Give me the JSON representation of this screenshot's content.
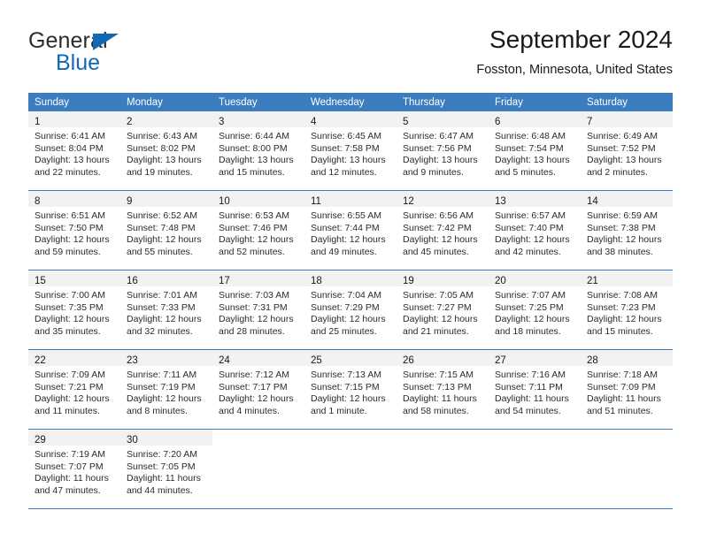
{
  "brand": {
    "name_top": "General",
    "name_bottom": "Blue",
    "accent_color": "#1268b3"
  },
  "header": {
    "title": "September 2024",
    "location": "Fosston, Minnesota, United States"
  },
  "calendar": {
    "header_bg_color": "#3b7dbf",
    "daynum_bg_color": "#f2f2f2",
    "weekdays": [
      "Sunday",
      "Monday",
      "Tuesday",
      "Wednesday",
      "Thursday",
      "Friday",
      "Saturday"
    ],
    "weeks": [
      [
        {
          "day": "1",
          "sunrise": "Sunrise: 6:41 AM",
          "sunset": "Sunset: 8:04 PM",
          "daylight1": "Daylight: 13 hours",
          "daylight2": "and 22 minutes."
        },
        {
          "day": "2",
          "sunrise": "Sunrise: 6:43 AM",
          "sunset": "Sunset: 8:02 PM",
          "daylight1": "Daylight: 13 hours",
          "daylight2": "and 19 minutes."
        },
        {
          "day": "3",
          "sunrise": "Sunrise: 6:44 AM",
          "sunset": "Sunset: 8:00 PM",
          "daylight1": "Daylight: 13 hours",
          "daylight2": "and 15 minutes."
        },
        {
          "day": "4",
          "sunrise": "Sunrise: 6:45 AM",
          "sunset": "Sunset: 7:58 PM",
          "daylight1": "Daylight: 13 hours",
          "daylight2": "and 12 minutes."
        },
        {
          "day": "5",
          "sunrise": "Sunrise: 6:47 AM",
          "sunset": "Sunset: 7:56 PM",
          "daylight1": "Daylight: 13 hours",
          "daylight2": "and 9 minutes."
        },
        {
          "day": "6",
          "sunrise": "Sunrise: 6:48 AM",
          "sunset": "Sunset: 7:54 PM",
          "daylight1": "Daylight: 13 hours",
          "daylight2": "and 5 minutes."
        },
        {
          "day": "7",
          "sunrise": "Sunrise: 6:49 AM",
          "sunset": "Sunset: 7:52 PM",
          "daylight1": "Daylight: 13 hours",
          "daylight2": "and 2 minutes."
        }
      ],
      [
        {
          "day": "8",
          "sunrise": "Sunrise: 6:51 AM",
          "sunset": "Sunset: 7:50 PM",
          "daylight1": "Daylight: 12 hours",
          "daylight2": "and 59 minutes."
        },
        {
          "day": "9",
          "sunrise": "Sunrise: 6:52 AM",
          "sunset": "Sunset: 7:48 PM",
          "daylight1": "Daylight: 12 hours",
          "daylight2": "and 55 minutes."
        },
        {
          "day": "10",
          "sunrise": "Sunrise: 6:53 AM",
          "sunset": "Sunset: 7:46 PM",
          "daylight1": "Daylight: 12 hours",
          "daylight2": "and 52 minutes."
        },
        {
          "day": "11",
          "sunrise": "Sunrise: 6:55 AM",
          "sunset": "Sunset: 7:44 PM",
          "daylight1": "Daylight: 12 hours",
          "daylight2": "and 49 minutes."
        },
        {
          "day": "12",
          "sunrise": "Sunrise: 6:56 AM",
          "sunset": "Sunset: 7:42 PM",
          "daylight1": "Daylight: 12 hours",
          "daylight2": "and 45 minutes."
        },
        {
          "day": "13",
          "sunrise": "Sunrise: 6:57 AM",
          "sunset": "Sunset: 7:40 PM",
          "daylight1": "Daylight: 12 hours",
          "daylight2": "and 42 minutes."
        },
        {
          "day": "14",
          "sunrise": "Sunrise: 6:59 AM",
          "sunset": "Sunset: 7:38 PM",
          "daylight1": "Daylight: 12 hours",
          "daylight2": "and 38 minutes."
        }
      ],
      [
        {
          "day": "15",
          "sunrise": "Sunrise: 7:00 AM",
          "sunset": "Sunset: 7:35 PM",
          "daylight1": "Daylight: 12 hours",
          "daylight2": "and 35 minutes."
        },
        {
          "day": "16",
          "sunrise": "Sunrise: 7:01 AM",
          "sunset": "Sunset: 7:33 PM",
          "daylight1": "Daylight: 12 hours",
          "daylight2": "and 32 minutes."
        },
        {
          "day": "17",
          "sunrise": "Sunrise: 7:03 AM",
          "sunset": "Sunset: 7:31 PM",
          "daylight1": "Daylight: 12 hours",
          "daylight2": "and 28 minutes."
        },
        {
          "day": "18",
          "sunrise": "Sunrise: 7:04 AM",
          "sunset": "Sunset: 7:29 PM",
          "daylight1": "Daylight: 12 hours",
          "daylight2": "and 25 minutes."
        },
        {
          "day": "19",
          "sunrise": "Sunrise: 7:05 AM",
          "sunset": "Sunset: 7:27 PM",
          "daylight1": "Daylight: 12 hours",
          "daylight2": "and 21 minutes."
        },
        {
          "day": "20",
          "sunrise": "Sunrise: 7:07 AM",
          "sunset": "Sunset: 7:25 PM",
          "daylight1": "Daylight: 12 hours",
          "daylight2": "and 18 minutes."
        },
        {
          "day": "21",
          "sunrise": "Sunrise: 7:08 AM",
          "sunset": "Sunset: 7:23 PM",
          "daylight1": "Daylight: 12 hours",
          "daylight2": "and 15 minutes."
        }
      ],
      [
        {
          "day": "22",
          "sunrise": "Sunrise: 7:09 AM",
          "sunset": "Sunset: 7:21 PM",
          "daylight1": "Daylight: 12 hours",
          "daylight2": "and 11 minutes."
        },
        {
          "day": "23",
          "sunrise": "Sunrise: 7:11 AM",
          "sunset": "Sunset: 7:19 PM",
          "daylight1": "Daylight: 12 hours",
          "daylight2": "and 8 minutes."
        },
        {
          "day": "24",
          "sunrise": "Sunrise: 7:12 AM",
          "sunset": "Sunset: 7:17 PM",
          "daylight1": "Daylight: 12 hours",
          "daylight2": "and 4 minutes."
        },
        {
          "day": "25",
          "sunrise": "Sunrise: 7:13 AM",
          "sunset": "Sunset: 7:15 PM",
          "daylight1": "Daylight: 12 hours",
          "daylight2": "and 1 minute."
        },
        {
          "day": "26",
          "sunrise": "Sunrise: 7:15 AM",
          "sunset": "Sunset: 7:13 PM",
          "daylight1": "Daylight: 11 hours",
          "daylight2": "and 58 minutes."
        },
        {
          "day": "27",
          "sunrise": "Sunrise: 7:16 AM",
          "sunset": "Sunset: 7:11 PM",
          "daylight1": "Daylight: 11 hours",
          "daylight2": "and 54 minutes."
        },
        {
          "day": "28",
          "sunrise": "Sunrise: 7:18 AM",
          "sunset": "Sunset: 7:09 PM",
          "daylight1": "Daylight: 11 hours",
          "daylight2": "and 51 minutes."
        }
      ],
      [
        {
          "day": "29",
          "sunrise": "Sunrise: 7:19 AM",
          "sunset": "Sunset: 7:07 PM",
          "daylight1": "Daylight: 11 hours",
          "daylight2": "and 47 minutes."
        },
        {
          "day": "30",
          "sunrise": "Sunrise: 7:20 AM",
          "sunset": "Sunset: 7:05 PM",
          "daylight1": "Daylight: 11 hours",
          "daylight2": "and 44 minutes."
        }
      ]
    ]
  }
}
